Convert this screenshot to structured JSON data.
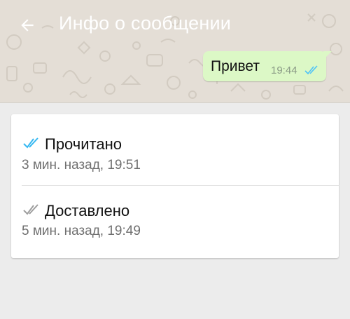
{
  "app_bar": {
    "title": "Инфо о сообщении",
    "back_icon": "arrow-back-icon"
  },
  "message": {
    "text": "Привет",
    "time": "19:44",
    "status_icon": "double-check-icon",
    "status_color": "#4fc3f7"
  },
  "receipts": [
    {
      "label": "Прочитано",
      "time": "3 мин. назад, 19:51",
      "icon": "double-check-icon",
      "icon_color": "#34b7f1"
    },
    {
      "label": "Доставлено",
      "time": "5 мин. назад, 19:49",
      "icon": "double-check-icon",
      "icon_color": "#9e9e9e"
    }
  ],
  "colors": {
    "bubble": "#dcf8c6",
    "chat_background": "#e4ded6",
    "page_background": "#ececec",
    "read_tick": "#34b7f1",
    "delivered_tick": "#9e9e9e"
  }
}
